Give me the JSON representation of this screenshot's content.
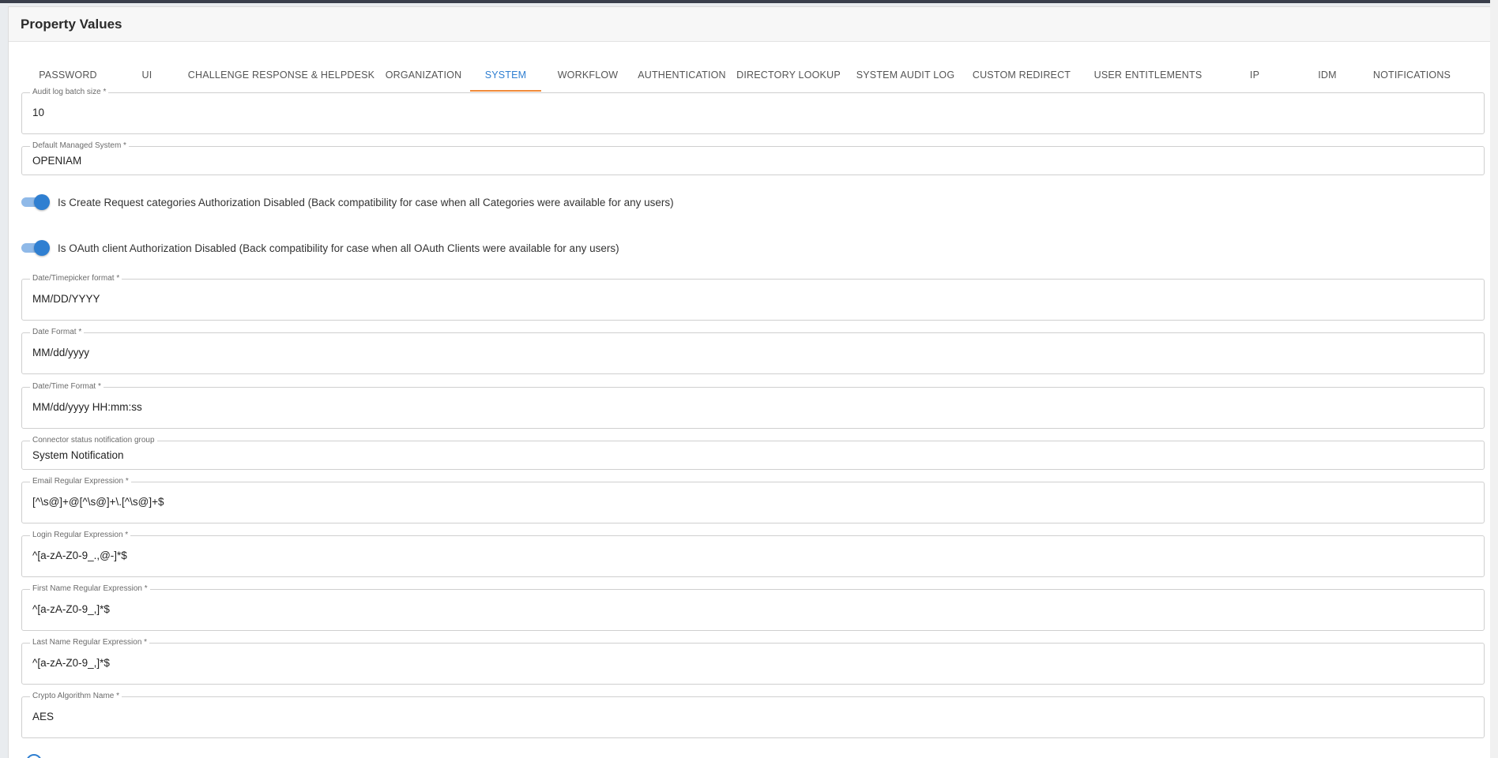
{
  "panel": {
    "title": "Property Values"
  },
  "tabs": [
    {
      "label": "PASSWORD",
      "active": false
    },
    {
      "label": "UI",
      "active": false
    },
    {
      "label": "CHALLENGE RESPONSE & HELPDESK",
      "active": false
    },
    {
      "label": "ORGANIZATION",
      "active": false
    },
    {
      "label": "SYSTEM",
      "active": true
    },
    {
      "label": "WORKFLOW",
      "active": false
    },
    {
      "label": "AUTHENTICATION",
      "active": false
    },
    {
      "label": "DIRECTORY LOOKUP",
      "active": false
    },
    {
      "label": "SYSTEM AUDIT LOG",
      "active": false
    },
    {
      "label": "CUSTOM REDIRECT",
      "active": false
    },
    {
      "label": "USER ENTITLEMENTS",
      "active": false
    },
    {
      "label": "IP",
      "active": false
    },
    {
      "label": "IDM",
      "active": false
    },
    {
      "label": "NOTIFICATIONS",
      "active": false
    }
  ],
  "fields": {
    "audit_log_batch_size": {
      "label": "Audit log batch size *",
      "value": "10"
    },
    "default_managed_system": {
      "label": "Default Managed System *",
      "value": "OPENIAM"
    },
    "date_timepicker_format": {
      "label": "Date/Timepicker format *",
      "value": "MM/DD/YYYY"
    },
    "date_format": {
      "label": "Date Format *",
      "value": "MM/dd/yyyy"
    },
    "date_time_format": {
      "label": "Date/Time Format *",
      "value": "MM/dd/yyyy HH:mm:ss"
    },
    "connector_status_group": {
      "label": "Connector status notification group",
      "value": "System Notification"
    },
    "email_regex": {
      "label": "Email Regular Expression *",
      "value": "[^\\s@]+@[^\\s@]+\\.[^\\s@]+$"
    },
    "login_regex": {
      "label": "Login Regular Expression *",
      "value": "^[a-zA-Z0-9_.,@-]*$"
    },
    "first_name_regex": {
      "label": "First Name Regular Expression *",
      "value": "^[a-zA-Z0-9_,]*$"
    },
    "last_name_regex": {
      "label": "Last Name Regular Expression *",
      "value": "^[a-zA-Z0-9_,]*$"
    },
    "crypto_algorithm": {
      "label": "Crypto Algorithm Name *",
      "value": "AES"
    }
  },
  "toggles": {
    "create_request_categories": {
      "label": "Is Create Request categories Authorization Disabled (Back compatibility for case when all Categories were available for any users)",
      "checked": true
    },
    "oauth_client": {
      "label": "Is OAuth client Authorization Disabled (Back compatibility for case when all OAuth Clients were available for any users)",
      "checked": true
    }
  },
  "colors": {
    "accent": "#2f7fd1",
    "active_underline": "#ef8a3a",
    "toggle_track": "#8fb9e8"
  }
}
